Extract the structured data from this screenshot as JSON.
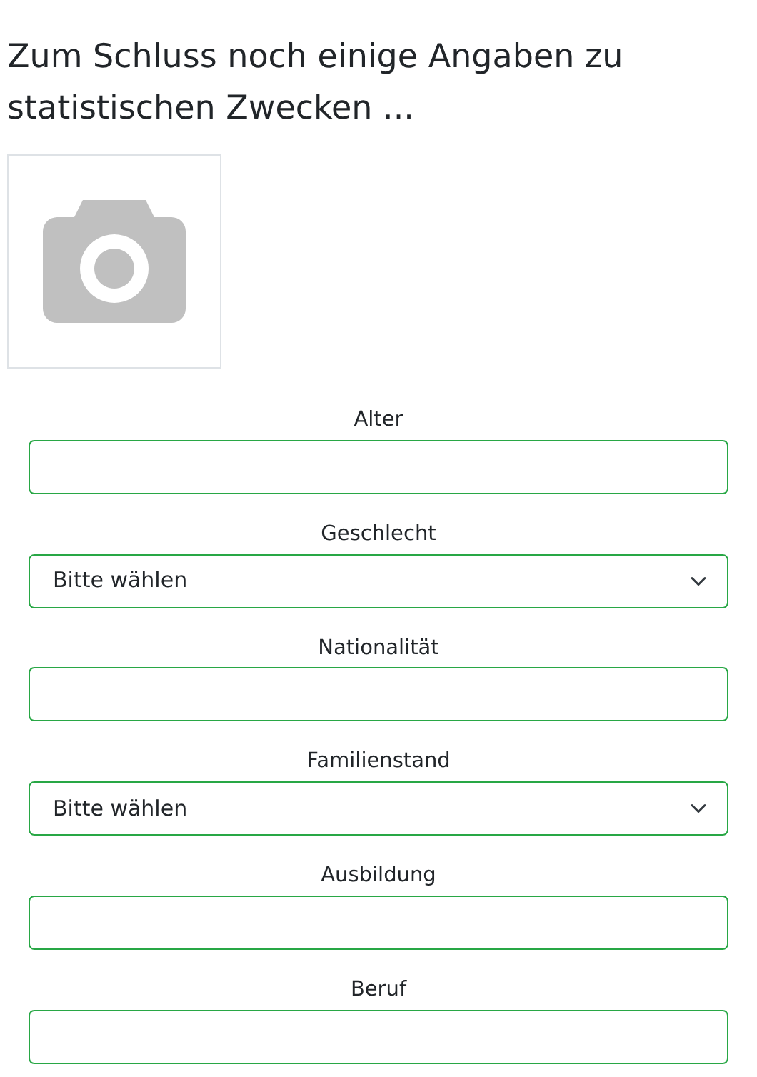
{
  "heading": "Zum Schluss noch einige Angaben zu statistischen Zwecken ...",
  "fields": [
    {
      "label": "Alter",
      "kind": "text"
    },
    {
      "label": "Geschlecht",
      "kind": "select",
      "value": "Bitte wählen"
    },
    {
      "label": "Nationalität",
      "kind": "text"
    },
    {
      "label": "Familienstand",
      "kind": "select",
      "value": "Bitte wählen"
    },
    {
      "label": "Ausbildung",
      "kind": "text"
    },
    {
      "label": "Beruf",
      "kind": "text"
    }
  ]
}
